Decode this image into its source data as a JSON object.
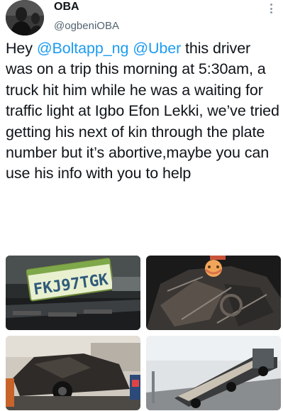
{
  "tweet": {
    "display_name": "OBA",
    "handle": "@ogbeniOBA",
    "text_parts": [
      "Hey ",
      "@Boltapp_ng",
      " ",
      "@Uber",
      " this driver was on a trip this morning at 5:30am, a truck hit him while he was a waiting for traffic light at Igbo Efon Lekki, we’ve tried getting his next of kin through the plate number but it’s abortive,maybe you can use his info with you to help"
    ]
  },
  "media": {
    "plate_text": "FKJ97TGK",
    "photos": [
      {
        "subject": "license-plate-on-bumper"
      },
      {
        "subject": "crushed-car-interior"
      },
      {
        "subject": "wrecked-car-on-tow-truck"
      },
      {
        "subject": "truck-on-road"
      }
    ]
  },
  "icons": {
    "more": "more-vertical-icon",
    "avatar": "avatar"
  },
  "colors": {
    "mention": "#1d9bf0",
    "secondary_text": "#536471",
    "primary_text": "#0f1419"
  }
}
